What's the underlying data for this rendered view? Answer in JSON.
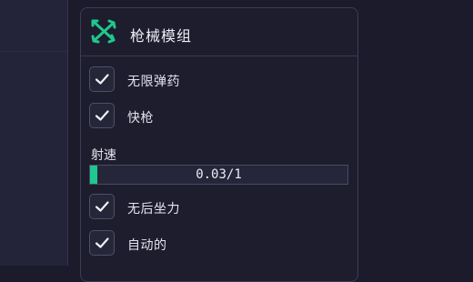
{
  "panel": {
    "title": "枪械模组",
    "icon": "crossed-guns-icon",
    "accent_color": "#1fc88e",
    "options": [
      {
        "label": "无限弹药",
        "checked": true
      },
      {
        "label": "快枪",
        "checked": true
      },
      {
        "label": "无后坐力",
        "checked": true
      },
      {
        "label": "自动的",
        "checked": true
      }
    ],
    "fire_rate": {
      "label": "射速",
      "value_text": "0.03/1",
      "value": 0.03,
      "max": 1
    }
  }
}
